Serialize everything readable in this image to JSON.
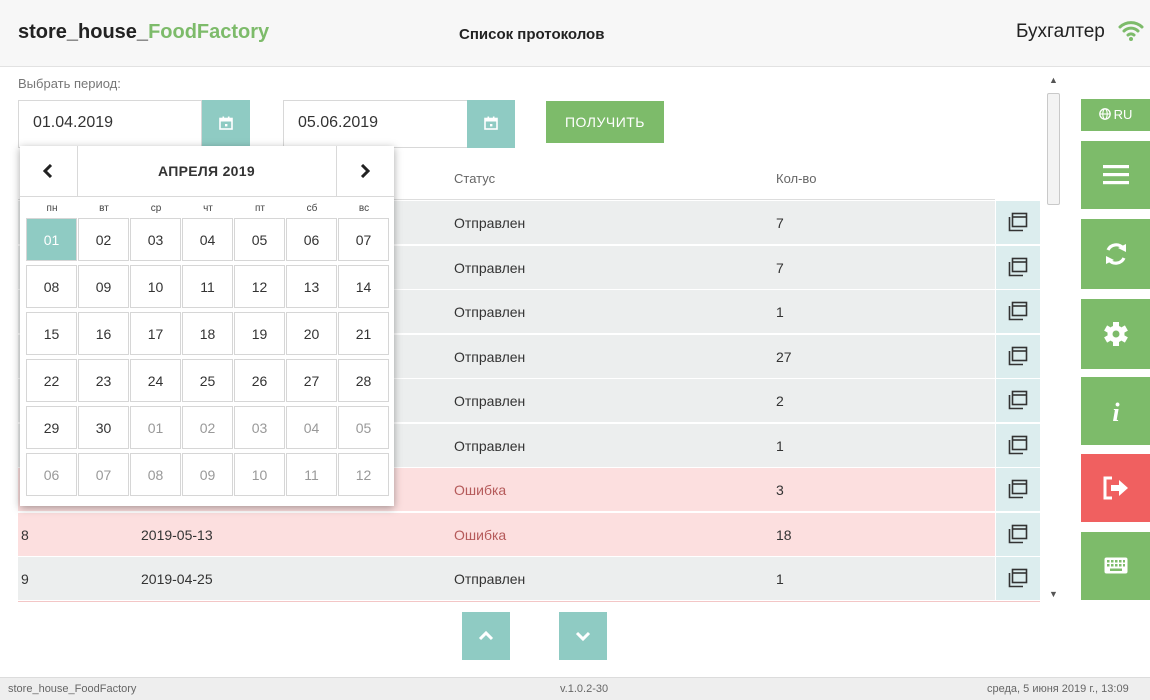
{
  "header": {
    "app_title_main": "store_house_",
    "app_title_accent": "FoodFactory",
    "page_title": "Список протоколов",
    "role": "Бухгалтер",
    "wifi_icon": "wifi-icon"
  },
  "period": {
    "label": "Выбрать период:",
    "date_from": "01.04.2019",
    "date_to": "05.06.2019",
    "get_button": "ПОЛУЧИТЬ"
  },
  "table": {
    "columns": [
      "Статус",
      "Кол-во"
    ],
    "rows": [
      {
        "num": "",
        "date": "",
        "status": "Отправлен",
        "qty": "7",
        "state": "ok"
      },
      {
        "num": "",
        "date": "",
        "status": "Отправлен",
        "qty": "7",
        "state": "ok"
      },
      {
        "num": "",
        "date": "",
        "status": "Отправлен",
        "qty": "1",
        "state": "ok"
      },
      {
        "num": "",
        "date": "",
        "status": "Отправлен",
        "qty": "27",
        "state": "ok"
      },
      {
        "num": "",
        "date": "",
        "status": "Отправлен",
        "qty": "2",
        "state": "ok"
      },
      {
        "num": "",
        "date": "",
        "status": "Отправлен",
        "qty": "1",
        "state": "ok"
      },
      {
        "num": "",
        "date": "",
        "status": "Ошибка",
        "qty": "3",
        "state": "err"
      },
      {
        "num": "8",
        "date": "2019-05-13",
        "status": "Ошибка",
        "qty": "18",
        "state": "err"
      },
      {
        "num": "9",
        "date": "2019-04-25",
        "status": "Отправлен",
        "qty": "1",
        "state": "ok"
      }
    ]
  },
  "sidebar": {
    "lang": "RU",
    "buttons": [
      {
        "name": "menu-button",
        "icon": "hamburger-icon",
        "color": "#7dbb6a"
      },
      {
        "name": "refresh-button",
        "icon": "refresh-icon",
        "color": "#7dbb6a"
      },
      {
        "name": "settings-button",
        "icon": "gear-icon",
        "color": "#7dbb6a"
      },
      {
        "name": "info-button",
        "icon": "info-icon",
        "color": "#7dbb6a"
      },
      {
        "name": "logout-button",
        "icon": "logout-icon",
        "color": "#f06060"
      },
      {
        "name": "keyboard-button",
        "icon": "keyboard-icon",
        "color": "#7dbb6a"
      }
    ]
  },
  "calendar": {
    "month": "АПРЕЛЯ 2019",
    "weekdays": [
      "пн",
      "вт",
      "ср",
      "чт",
      "пт",
      "сб",
      "вс"
    ],
    "weeks": [
      [
        "01",
        "02",
        "03",
        "04",
        "05",
        "06",
        "07"
      ],
      [
        "08",
        "09",
        "10",
        "11",
        "12",
        "13",
        "14"
      ],
      [
        "15",
        "16",
        "17",
        "18",
        "19",
        "20",
        "21"
      ],
      [
        "22",
        "23",
        "24",
        "25",
        "26",
        "27",
        "28"
      ],
      [
        "29",
        "30",
        "01",
        "02",
        "03",
        "04",
        "05"
      ],
      [
        "06",
        "07",
        "08",
        "09",
        "10",
        "11",
        "12"
      ]
    ],
    "selected": "01"
  },
  "footer": {
    "left": "store_house_FoodFactory",
    "center": "v.1.0.2-30",
    "right": "среда, 5 июня 2019 г., 13:09"
  },
  "colors": {
    "accent_green": "#7dbb6a",
    "teal": "#8fcbc3",
    "error_red": "#f06060"
  }
}
